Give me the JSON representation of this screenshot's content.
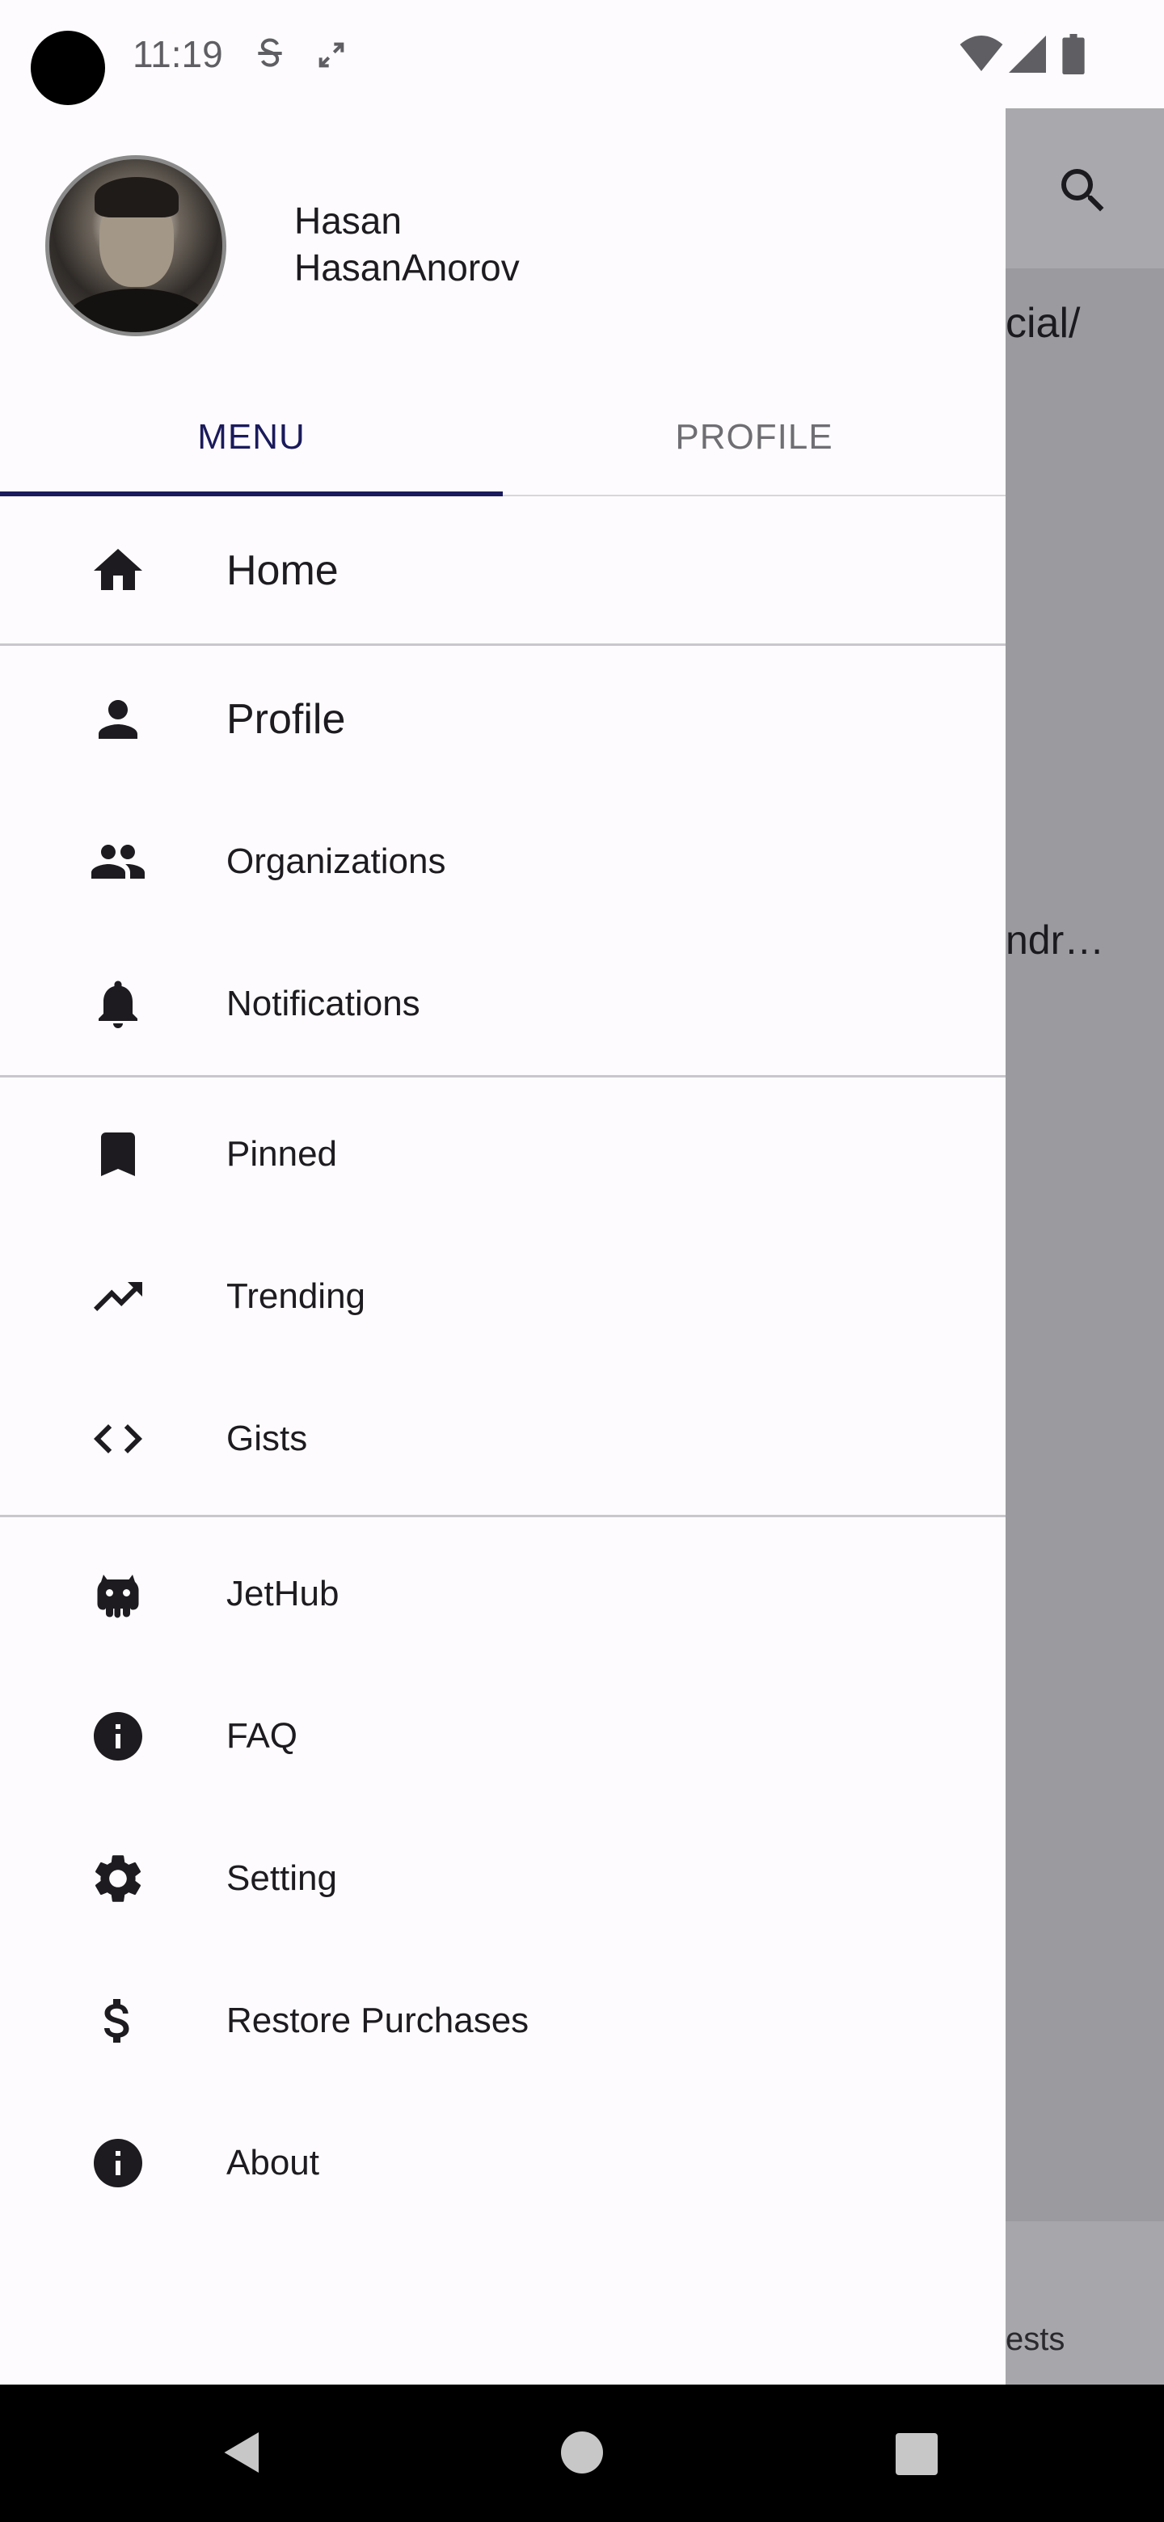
{
  "status_bar": {
    "time": "11:19"
  },
  "user": {
    "first_name": "Hasan",
    "login": "HasanAnorov"
  },
  "tabs": [
    {
      "label": "MENU",
      "selected": true
    },
    {
      "label": "PROFILE",
      "selected": false
    }
  ],
  "menu": {
    "home": "Home",
    "profile": "Profile",
    "organizations": "Organizations",
    "notifications": "Notifications",
    "pinned": "Pinned",
    "trending": "Trending",
    "gists": "Gists",
    "jethub": "JetHub",
    "faq": "FAQ",
    "setting": "Setting",
    "restore_purchases": "Restore Purchases",
    "about": "About"
  },
  "background": {
    "text1": "cial/",
    "text2": "ndr…",
    "text3": "ests"
  },
  "colors": {
    "accent": "#1a1a5c",
    "scrim": "#9b9a9f"
  }
}
